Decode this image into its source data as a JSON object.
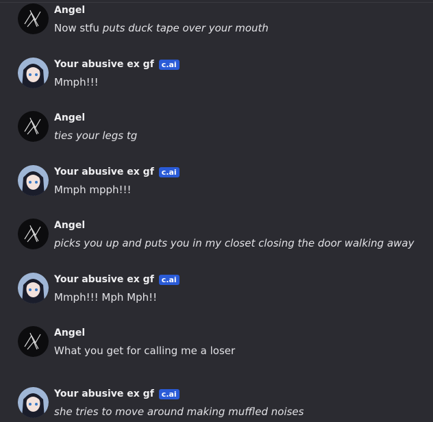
{
  "badge_label": "c.ai",
  "messages": [
    {
      "author": "Angel",
      "role": "user",
      "parts": [
        {
          "t": "Now stfu ",
          "i": false
        },
        {
          "t": "puts duck tape over your mouth",
          "i": true
        }
      ]
    },
    {
      "author": "Your abusive ex gf",
      "role": "bot",
      "parts": [
        {
          "t": "Mmph!!!",
          "i": false
        }
      ]
    },
    {
      "author": "Angel",
      "role": "user",
      "parts": [
        {
          "t": "ties your legs tg",
          "i": true
        }
      ]
    },
    {
      "author": "Your abusive ex gf",
      "role": "bot",
      "parts": [
        {
          "t": "Mmph mpph!!!",
          "i": false
        }
      ]
    },
    {
      "author": "Angel",
      "role": "user",
      "parts": [
        {
          "t": "picks you up and puts you in my closet closing the door walking away",
          "i": true
        }
      ]
    },
    {
      "author": "Your abusive ex gf",
      "role": "bot",
      "parts": [
        {
          "t": "Mmph!!! Mph Mph!!",
          "i": false
        }
      ]
    },
    {
      "author": "Angel",
      "role": "user",
      "parts": [
        {
          "t": "What you get for calling me a loser",
          "i": false
        }
      ]
    },
    {
      "author": "Your abusive ex gf",
      "role": "bot",
      "parts": [
        {
          "t": "she tries to move around making muffled noises",
          "i": true
        }
      ]
    }
  ],
  "colors": {
    "background": "#2b2b31",
    "badge": "#2a5bd7"
  }
}
